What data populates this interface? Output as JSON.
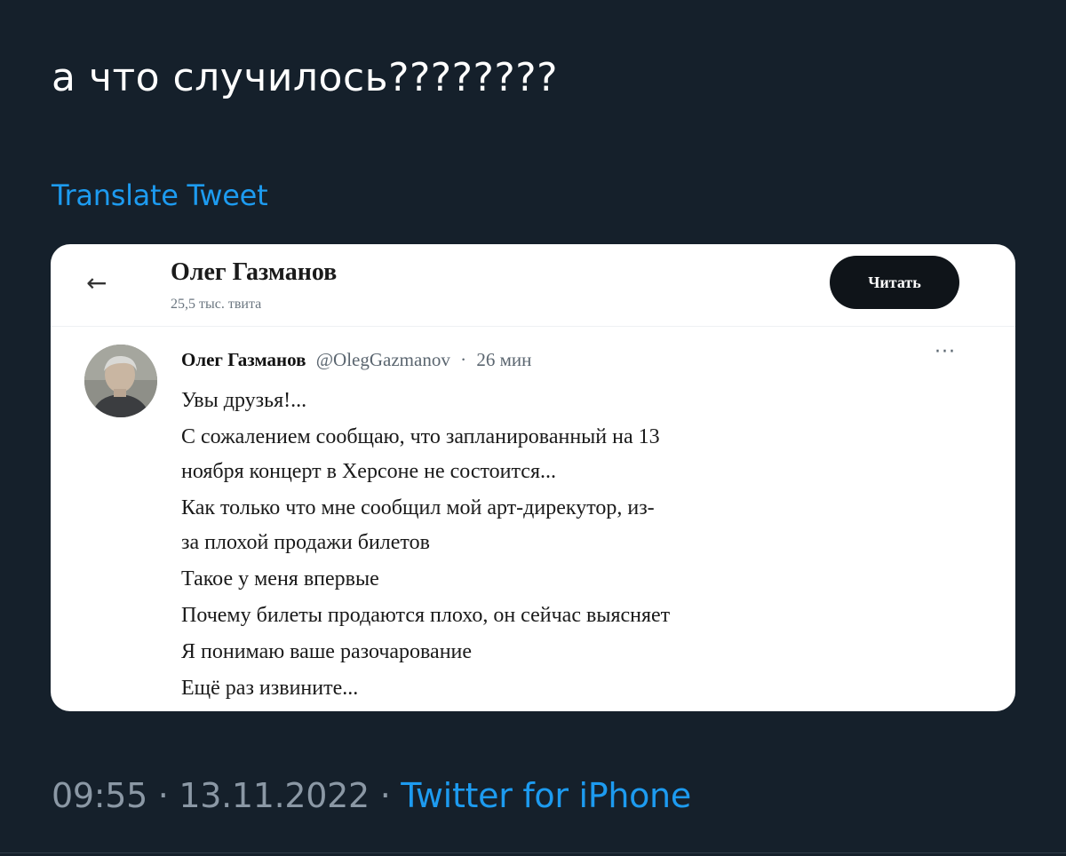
{
  "tweet": {
    "text": "а что случилось????????",
    "translate_label": "Translate Tweet"
  },
  "screenshot": {
    "header": {
      "back_icon": "back-arrow-icon",
      "profile_name": "Олег Газманов",
      "tweet_count": "25,5 тыс. твита",
      "follow_button": "Читать"
    },
    "post": {
      "author_name": "Олег Газманов",
      "author_handle": "@OlegGazmanov",
      "separator": "·",
      "time": "26 мин",
      "more_icon": "more-dots-icon",
      "lines": [
        "Увы друзья!...",
        "С сожалением сообщаю, что запланированный на 13",
        "ноября концерт в Херсоне не состоится...",
        "Как только что мне сообщил мой арт-дирекутор, из-",
        "за плохой продажи билетов",
        "Такое у меня впервые",
        "Почему билеты продаются плохо, он сейчас выясняет",
        "Я понимаю ваше разочарование",
        "Ещё раз извините..."
      ]
    }
  },
  "meta": {
    "time": "09:55",
    "sep1": " · ",
    "date": "13.11.2022",
    "sep2": " · ",
    "client": "Twitter for iPhone"
  },
  "colors": {
    "background": "#15202b",
    "link": "#1d9bf0",
    "muted": "#8b98a5"
  }
}
